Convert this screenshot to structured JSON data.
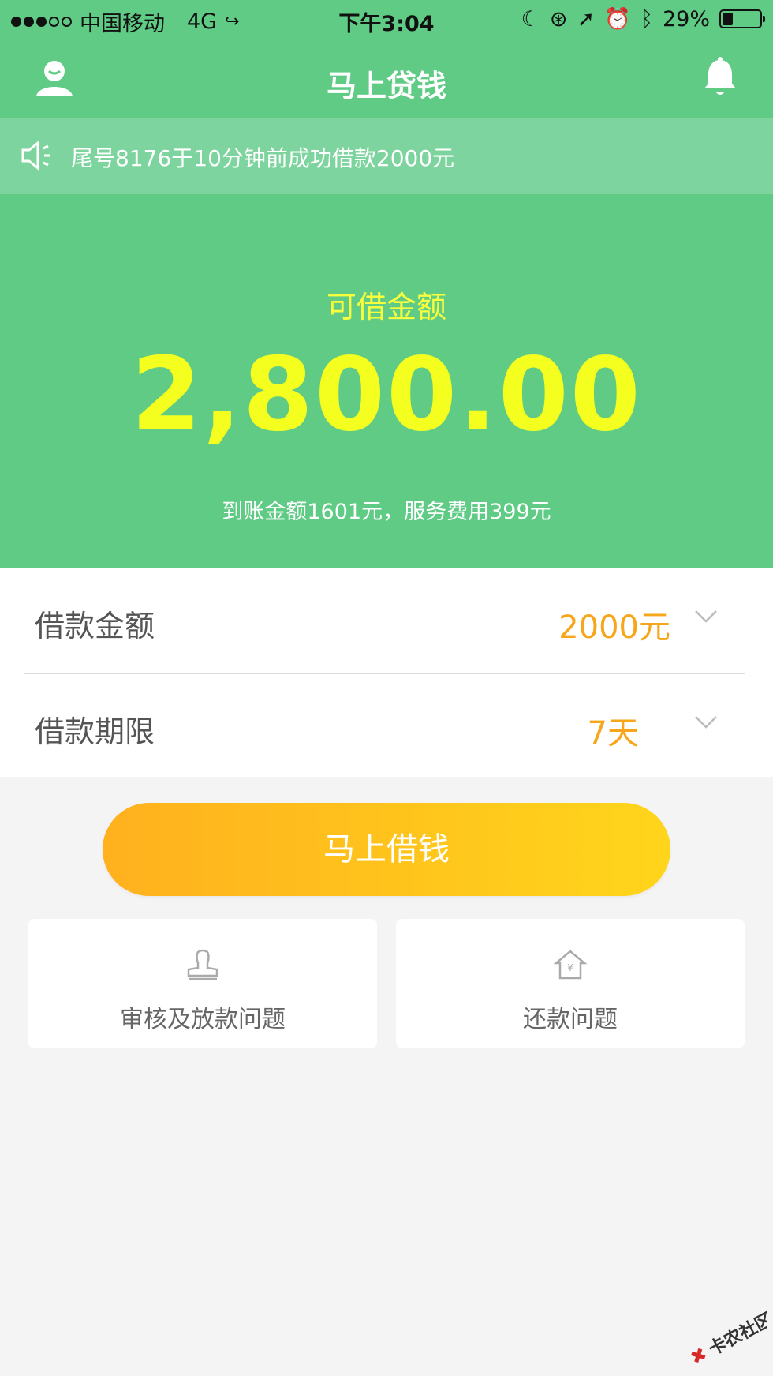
{
  "status_bar": {
    "carrier": "中国移动",
    "network": "4G",
    "time": "下午3:04",
    "battery": "29%",
    "battery_level": 0.29
  },
  "header": {
    "title": "马上贷钱"
  },
  "notice": {
    "text": "尾号8176于10分钟前成功借款2000元"
  },
  "hero": {
    "label": "可借金额",
    "amount": "2,800.00",
    "subtext": "到账金额1601元，服务费用399元"
  },
  "form": {
    "rows": [
      {
        "label": "借款金额",
        "value": "2000元"
      },
      {
        "label": "借款期限",
        "value": "7天"
      }
    ]
  },
  "actions": {
    "borrow_label": "马上借钱"
  },
  "cards": [
    {
      "title": "审核及放款问题"
    },
    {
      "title": "还款问题"
    }
  ],
  "watermark": {
    "text": "卡农社区"
  },
  "colors": {
    "primary_green": "#5fcb85",
    "notice_green": "#7ed49e",
    "amount_yellow": "#f4ff1f",
    "accent_orange": "#f7a51a"
  }
}
